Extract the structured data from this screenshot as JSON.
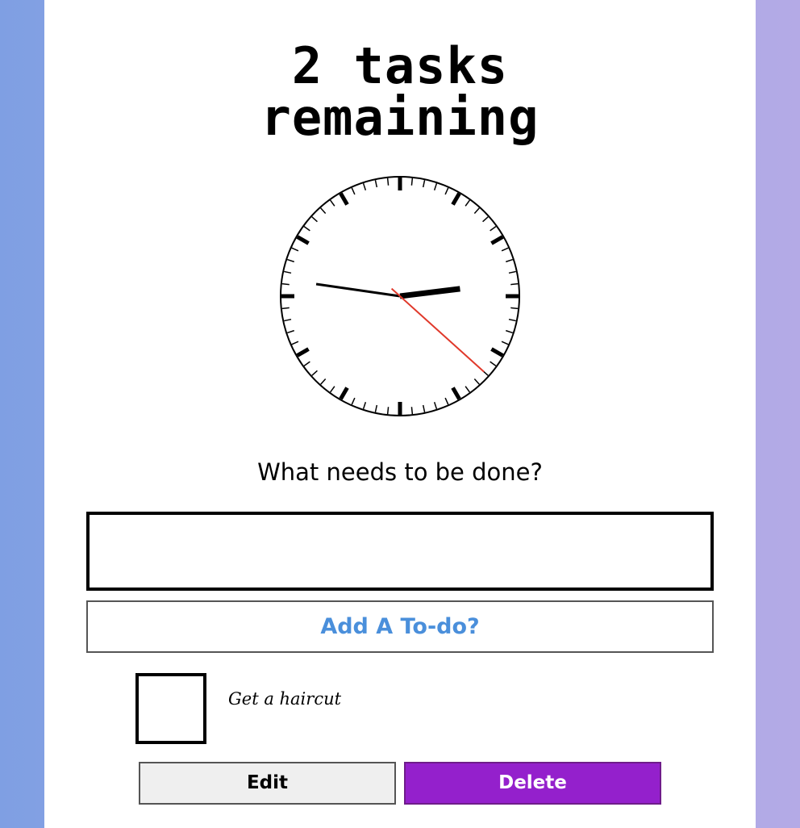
{
  "header": {
    "title_line1": "2 tasks",
    "title_line2": "remaining"
  },
  "clock": {
    "icon": "analog-clock-icon",
    "hour": 2,
    "minute": 46,
    "second": 22,
    "second_hand_color": "#e0392b"
  },
  "form": {
    "prompt": "What needs to be done?",
    "input_value": "",
    "add_button_label": "Add A To-do?"
  },
  "todos": [
    {
      "text": "Get a haircut",
      "checked": false,
      "edit_label": "Edit",
      "delete_label": "Delete"
    }
  ],
  "colors": {
    "add_button_text": "#4a8fdb",
    "delete_button_bg": "#9420cc",
    "edit_button_bg": "#efefef"
  }
}
